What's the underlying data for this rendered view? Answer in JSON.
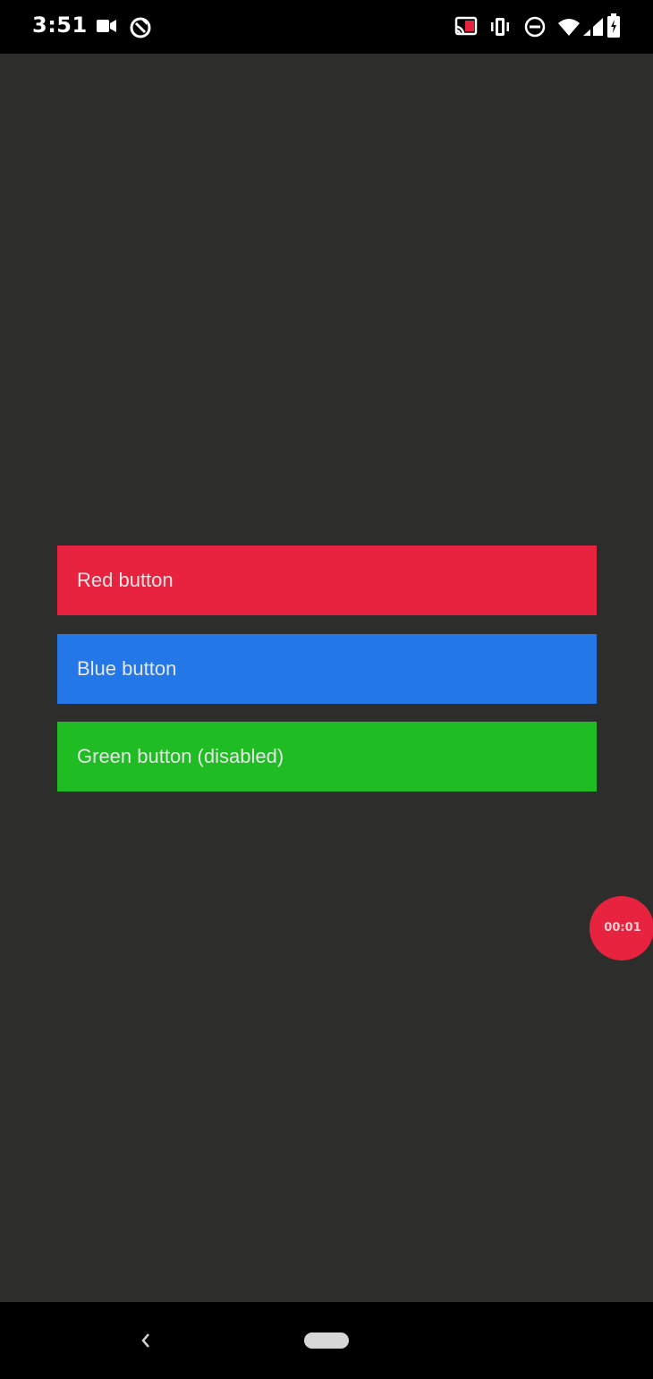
{
  "status_bar": {
    "time": "3:51",
    "icons": [
      "video-camera-icon",
      "sync-icon",
      "cast-icon",
      "vibrate-icon",
      "do-not-disturb-icon",
      "wifi-icon",
      "signal-icon",
      "battery-icon"
    ]
  },
  "buttons": [
    {
      "label": "Red button",
      "color": "#e8233f"
    },
    {
      "label": "Blue button",
      "color": "#2377e7"
    },
    {
      "label": "Green button (disabled)",
      "color": "#20bc23",
      "disabled": true
    }
  ],
  "timer": {
    "label": "00:01",
    "color": "#e8233f"
  },
  "nav_bar": {
    "icons": [
      "back-icon",
      "home-pill-icon"
    ]
  }
}
